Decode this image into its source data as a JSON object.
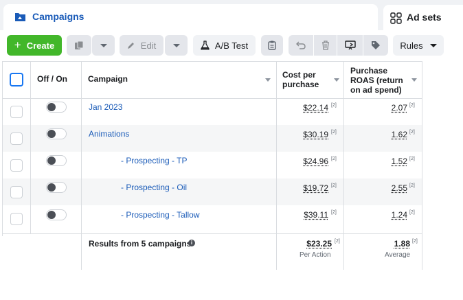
{
  "tabs": {
    "campaigns": "Campaigns",
    "ad_sets": "Ad sets"
  },
  "toolbar": {
    "create": "Create",
    "edit": "Edit",
    "ab_test": "A/B Test",
    "rules": "Rules"
  },
  "table": {
    "headers": {
      "off_on": "Off / On",
      "campaign": "Campaign",
      "cost_line1": "Cost per",
      "cost_line2": "purchase",
      "roas_line1": "Purchase",
      "roas_line2": "ROAS (return",
      "roas_line3": "on ad spend)"
    },
    "rows": [
      {
        "name": "Jan 2023",
        "cost": "$22.14",
        "cost_ref": "[2]",
        "roas": "2.07",
        "roas_ref": "[2]"
      },
      {
        "name": "Animations",
        "cost": "$30.19",
        "cost_ref": "[2]",
        "roas": "1.62",
        "roas_ref": "[2]"
      },
      {
        "name": "- Prospecting - TP",
        "cost": "$24.96",
        "cost_ref": "[2]",
        "roas": "1.52",
        "roas_ref": "[2]"
      },
      {
        "name": "- Prospecting - Oil",
        "cost": "$19.72",
        "cost_ref": "[2]",
        "roas": "2.55",
        "roas_ref": "[2]"
      },
      {
        "name": "- Prospecting - Tallow",
        "cost": "$39.11",
        "cost_ref": "[2]",
        "roas": "1.24",
        "roas_ref": "[2]"
      }
    ],
    "totals": {
      "label": "Results from 5 campaigns",
      "info_icon": "i",
      "cost": "$23.25",
      "cost_ref": "[2]",
      "cost_note": "Per Action",
      "roas": "1.88",
      "roas_ref": "[2]",
      "roas_note": "Average"
    }
  },
  "colors": {
    "link": "#1a5bb8",
    "create_green": "#42b72a",
    "row_stripe": "#f5f6f7"
  }
}
